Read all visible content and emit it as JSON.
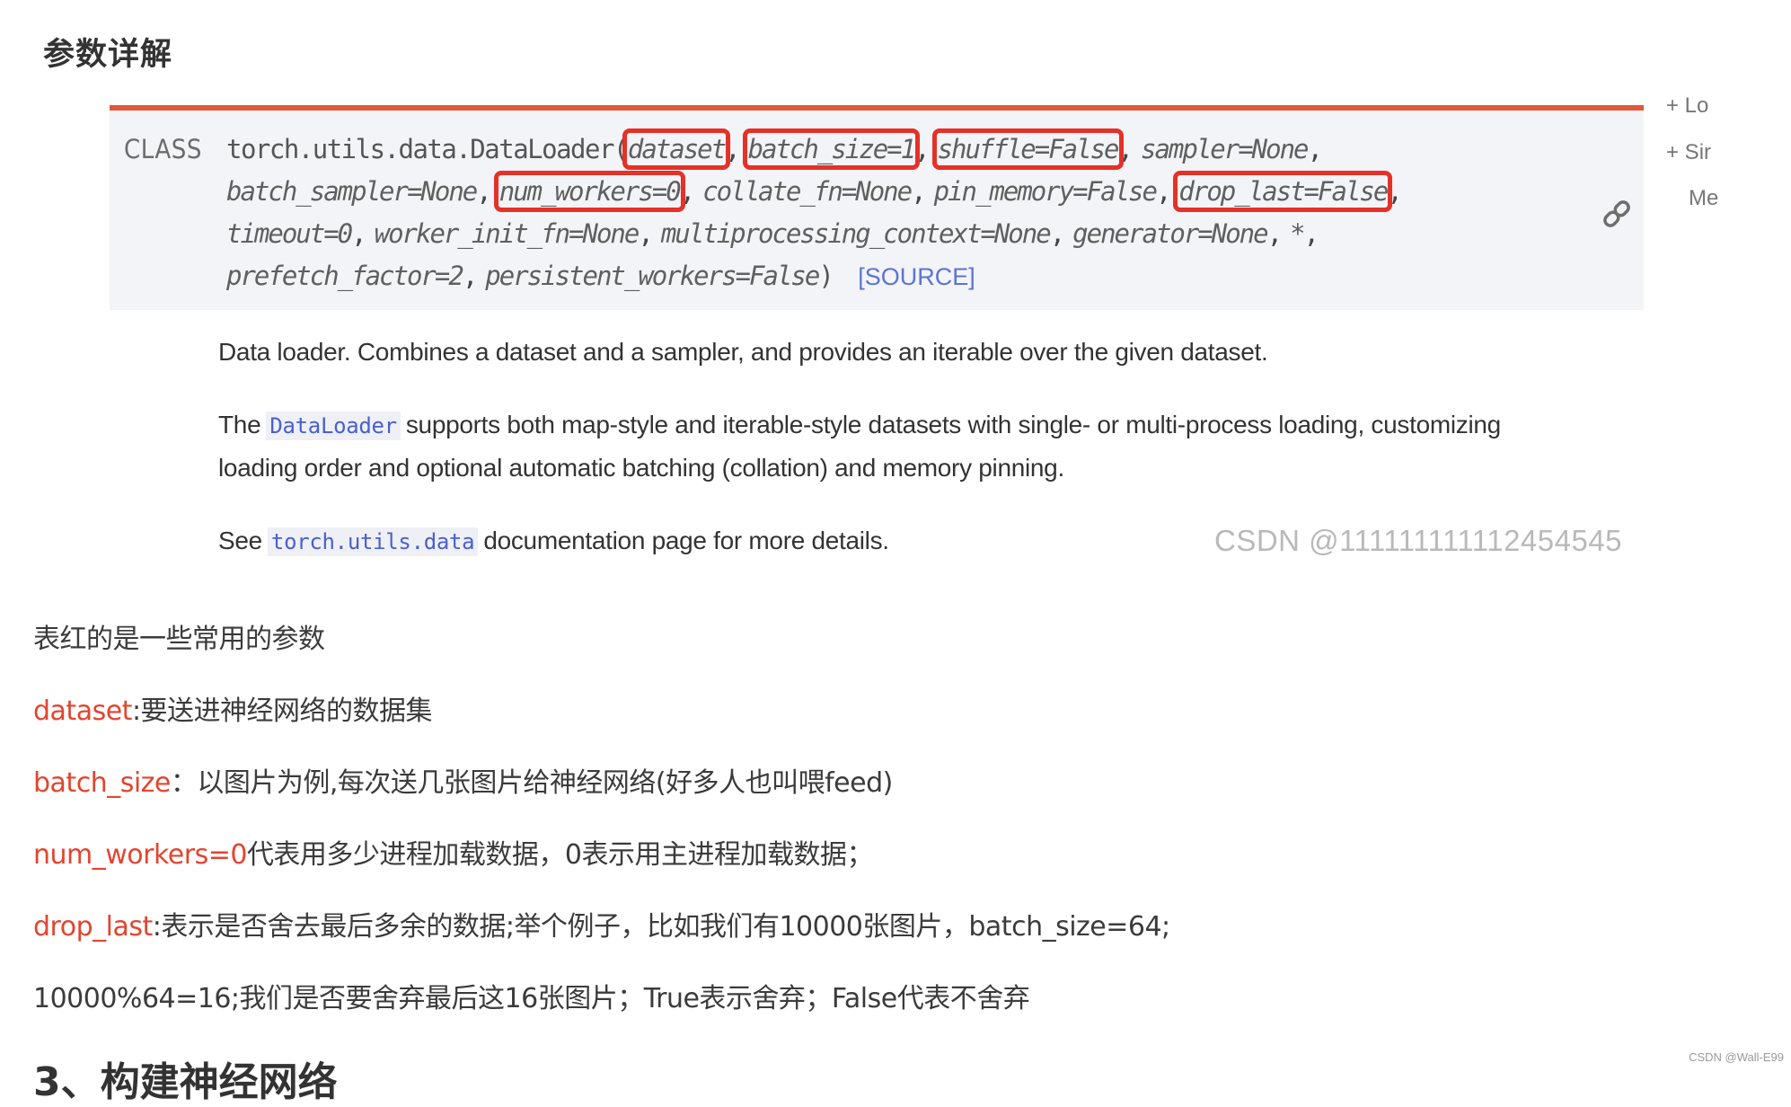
{
  "section_title": "参数详解",
  "signature": {
    "keyword": "CLASS",
    "function_name": "torch.utils.data.DataLoader(",
    "params_line1": [
      {
        "text": "dataset",
        "highlighted": true
      },
      {
        "text": "batch_size=1",
        "highlighted": true
      },
      {
        "text": "shuffle=False",
        "highlighted": true
      },
      {
        "text": "sampler=None",
        "highlighted": false
      }
    ],
    "params_line2": [
      {
        "text": "batch_sampler=None",
        "highlighted": false
      },
      {
        "text": "num_workers=0",
        "highlighted": true
      },
      {
        "text": "collate_fn=None",
        "highlighted": false
      },
      {
        "text": "pin_memory=False",
        "highlighted": false
      },
      {
        "text": "drop_last=False",
        "highlighted": true
      }
    ],
    "params_line3": [
      {
        "text": "timeout=0",
        "highlighted": false
      },
      {
        "text": "worker_init_fn=None",
        "highlighted": false
      },
      {
        "text": "multiprocessing_context=None",
        "highlighted": false
      },
      {
        "text": "generator=None",
        "highlighted": false
      },
      {
        "text": "*",
        "highlighted": false
      }
    ],
    "params_line4": [
      {
        "text": "prefetch_factor=2",
        "highlighted": false
      },
      {
        "text": "persistent_workers=False",
        "highlighted": false
      }
    ],
    "closing": ")",
    "source_link": "[SOURCE]",
    "highlight_color": "#e53127",
    "accent_color": "#e0583a"
  },
  "toc": {
    "items": [
      "+ Lo",
      "+ Sir",
      "Me"
    ]
  },
  "description": {
    "p1": "Data loader. Combines a dataset and a sampler, and provides an iterable over the given dataset.",
    "p2_prefix": "The",
    "p2_code": "DataLoader",
    "p2_line1_suffix": "supports both map-style and iterable-style datasets with single- or multi-process loading, customizing",
    "p2_line2": "loading order and optional automatic batching (collation) and memory pinning.",
    "p3_prefix": "See",
    "p3_code": "torch.utils.data",
    "p3_suffix": "documentation page for more details."
  },
  "watermark_main": "CSDN @111111111112454545",
  "notes": {
    "intro": "表红的是一些常用的参数",
    "items": [
      {
        "term": "dataset",
        "text": ":要送进神经网络的数据集"
      },
      {
        "term": "batch_size",
        "text": "：以图片为例,每次送几张图片给神经网络(好多人也叫喂feed)"
      },
      {
        "term": "num_workers=0",
        "text": "代表用多少进程加载数据，0表示用主进程加载数据；"
      },
      {
        "term": "drop_last",
        "text": ":表示是否舍去最后多余的数据;举个例子，比如我们有10000张图片，batch_size=64;"
      }
    ],
    "followup": "10000%64=16;我们是否要舍弃最后这16张图片；True表示舍弃；False代表不舍弃",
    "term_color": "#e2452f"
  },
  "next_heading": "3、构建神经网络",
  "corner_watermark": "CSDN @Wall-E99"
}
